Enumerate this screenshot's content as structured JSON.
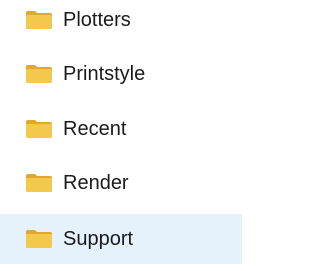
{
  "colors": {
    "folder_body": "#f2c94c",
    "folder_tab": "#e0a82e",
    "selected_row": "#e5f1fb",
    "text": "#1a1a1a"
  },
  "items": [
    {
      "label": "Plotters",
      "icon": "folder-icon",
      "selected": false
    },
    {
      "label": "Printstyle",
      "icon": "folder-icon",
      "selected": false
    },
    {
      "label": "Recent",
      "icon": "folder-icon",
      "selected": false
    },
    {
      "label": "Render",
      "icon": "folder-icon",
      "selected": false
    },
    {
      "label": "Support",
      "icon": "folder-icon",
      "selected": true
    }
  ]
}
